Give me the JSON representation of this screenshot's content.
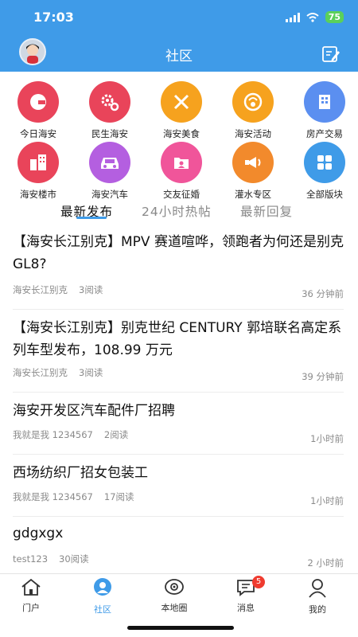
{
  "status": {
    "time": "17:03",
    "battery": "75"
  },
  "header": {
    "title": "社区"
  },
  "categories": [
    {
      "label": "今日海安",
      "icon": "today-haian-icon",
      "color": "#e9445a"
    },
    {
      "label": "民生海安",
      "icon": "livelihood-icon",
      "color": "#e9445a"
    },
    {
      "label": "海安美食",
      "icon": "food-icon",
      "color": "#f6a21e"
    },
    {
      "label": "海安活动",
      "icon": "activity-icon",
      "color": "#f6a21e"
    },
    {
      "label": "房产交易",
      "icon": "real-estate-icon",
      "color": "#5b8ff0"
    },
    {
      "label": "海安楼市",
      "icon": "housing-market-icon",
      "color": "#e9445a"
    },
    {
      "label": "海安汽车",
      "icon": "car-icon",
      "color": "#b45fe0"
    },
    {
      "label": "交友征婚",
      "icon": "dating-icon",
      "color": "#f0559a"
    },
    {
      "label": "灌水专区",
      "icon": "chat-zone-icon",
      "color": "#f28a2c"
    },
    {
      "label": "全部版块",
      "icon": "all-boards-icon",
      "color": "#3f9be8"
    }
  ],
  "tabs": [
    {
      "label": "最新发布",
      "active": true
    },
    {
      "label": "24小时热帖",
      "active": false
    },
    {
      "label": "最新回复",
      "active": false
    }
  ],
  "posts": [
    {
      "title": "【海安长江别克】MPV 赛道喧哗，领跑者为何还是别克 GL8?",
      "author": "海安长江别克",
      "reads": "3阅读",
      "time": "36 分钟前"
    },
    {
      "title": "【海安长江别克】别克世纪 CENTURY 郭培联名高定系列车型发布，108.99 万元",
      "author": "海安长江别克",
      "reads": "3阅读",
      "time": "39 分钟前"
    },
    {
      "title": "海安开发区汽车配件厂招聘",
      "author": "我就是我 1234567",
      "reads": "2阅读",
      "time": "1小时前"
    },
    {
      "title": "西场纺织厂招女包装工",
      "author": "我就是我 1234567",
      "reads": "17阅读",
      "time": "1小时前"
    },
    {
      "title": "gdgxgx",
      "author": "test123",
      "reads": "30阅读",
      "time": "2 小时前"
    }
  ],
  "tabbar": [
    {
      "label": "门户",
      "icon": "home-icon"
    },
    {
      "label": "社区",
      "icon": "community-icon",
      "active": true
    },
    {
      "label": "本地圈",
      "icon": "local-circle-icon"
    },
    {
      "label": "消息",
      "icon": "message-icon",
      "badge": "5"
    },
    {
      "label": "我的",
      "icon": "profile-icon"
    }
  ]
}
